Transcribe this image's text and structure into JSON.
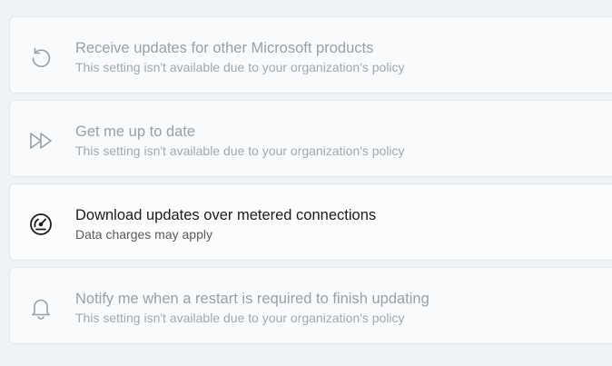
{
  "settings": [
    {
      "title": "Receive updates for other Microsoft products",
      "subtitle": "This setting isn't available due to your organization's policy",
      "icon": "refresh-icon",
      "enabled": false
    },
    {
      "title": "Get me up to date",
      "subtitle": "This setting isn't available due to your organization's policy",
      "icon": "fast-forward-icon",
      "enabled": false
    },
    {
      "title": "Download updates over metered connections",
      "subtitle": "Data charges may apply",
      "icon": "speedometer-icon",
      "enabled": true
    },
    {
      "title": "Notify me when a restart is required to finish updating",
      "subtitle": "This setting isn't available due to your organization's policy",
      "icon": "bell-icon",
      "enabled": false
    }
  ],
  "colors": {
    "disabled_text": "#9aa0a6",
    "enabled_text": "#1b1b1b",
    "card_border": "#e3e7ec"
  }
}
